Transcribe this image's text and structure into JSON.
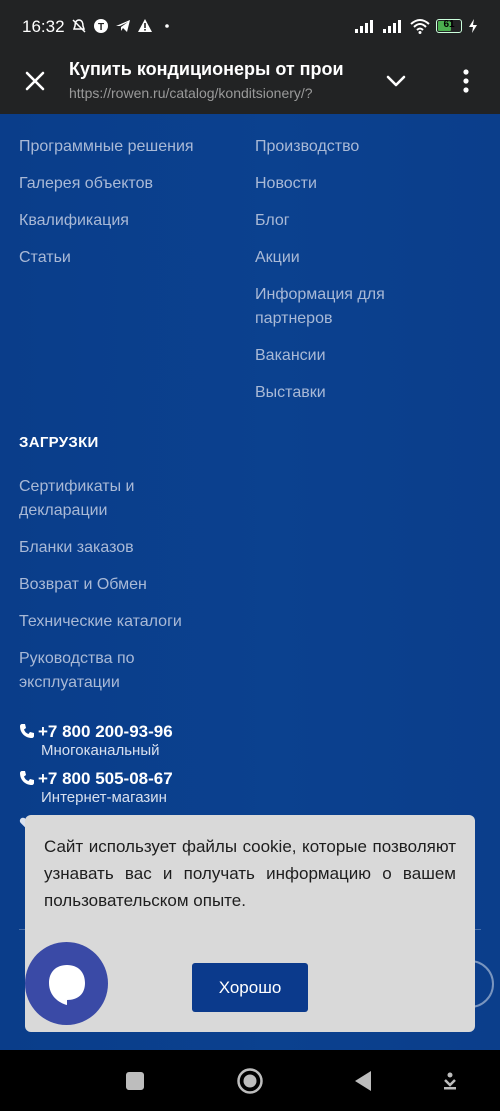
{
  "status_bar": {
    "time": "16:32",
    "battery_percent": 61,
    "battery_text": "61",
    "icons_left": [
      "mute-icon",
      "t-icon",
      "telegram-icon",
      "warning-icon",
      "dot-icon"
    ],
    "icons_right": [
      "signal-icon",
      "signal-icon",
      "wifi-icon",
      "battery-icon",
      "charging-icon"
    ]
  },
  "browser": {
    "title": "Купить кондиционеры от прои",
    "url": "https://rowen.ru/catalog/konditsionery/?"
  },
  "footer": {
    "left_links": [
      "Программные решения",
      "Галерея объектов",
      "Квалификация",
      "Статьи"
    ],
    "right_links": [
      "Производство",
      "Новости",
      "Блог",
      "Акции",
      "Информация для партнеров",
      "Вакансии",
      "Выставки"
    ],
    "downloads_title": "ЗАГРУЗКИ",
    "downloads_links": [
      "Сертификаты и декларации",
      "Бланки заказов",
      "Возврат и Обмен",
      "Технические каталоги",
      "Руководства по эксплуатации"
    ],
    "phones": [
      {
        "number": "+7 800 200-93-96",
        "label": "Многоканальный"
      },
      {
        "number": "+7 800 505-08-67",
        "label": "Интернет-магазин"
      }
    ]
  },
  "cookie": {
    "text": "Сайт использует файлы cookie, которые позволяют узнавать вас и получать информацию о вашем пользовательском опыте.",
    "button": "Хорошо"
  },
  "colors": {
    "brand_blue": "#0b418f",
    "button_blue": "#0b3a8c",
    "chat_purple": "#3a4aa6"
  }
}
